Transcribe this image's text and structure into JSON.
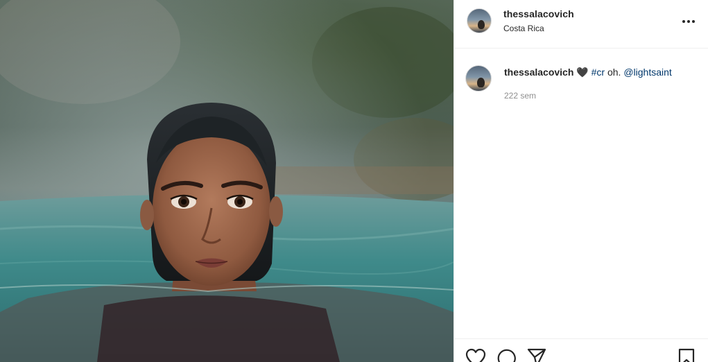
{
  "header": {
    "username": "thessalacovich",
    "location": "Costa Rica",
    "more_icon": "more-horizontal-icon"
  },
  "caption": {
    "username": "thessalacovich",
    "heart_emoji": "🖤",
    "hashtag": "#cr",
    "text": " oh. ",
    "mention": "@lightsaint",
    "time": "222 sem"
  },
  "actions": {
    "icons": [
      "heart-icon",
      "comment-icon",
      "share-icon",
      "bookmark-icon"
    ]
  },
  "colors": {
    "text": "#262626",
    "link": "#00376b",
    "secondary": "#8e8e8e",
    "divider": "#efefef"
  }
}
